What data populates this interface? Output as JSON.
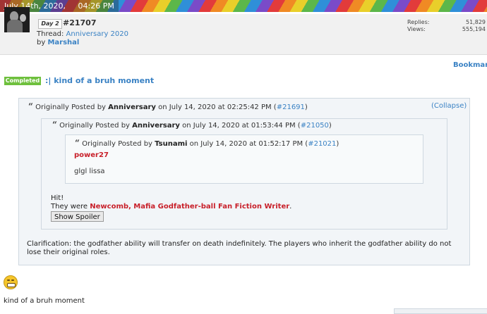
{
  "header": {
    "date": "July 14th, 2020,",
    "time": "04:26 PM"
  },
  "post": {
    "day_badge": "Day 2",
    "number": "#21707",
    "thread_prefix": "Thread:",
    "thread_name": "Anniversary 2020",
    "by_prefix": "by",
    "author": "Marshal",
    "stats": {
      "replies_label": "Replies:",
      "replies_value": "51,829",
      "views_label": "Views:",
      "views_value": "555,194"
    }
  },
  "bookmark_label": "Bookmark",
  "thread_status": {
    "badge": "Completed",
    "title": ":| kind of a bruh moment"
  },
  "quote1": {
    "prefix": "Originally Posted by",
    "author": "Anniversary",
    "date": "on July 14, 2020 at 02:25:42 PM (",
    "link": "#21691",
    "close": ")",
    "collapse": "(Collapse)"
  },
  "quote2": {
    "prefix": "Originally Posted by",
    "author": "Anniversary",
    "date": "on July 14, 2020 at 01:53:44 PM (",
    "link": "#21050",
    "close": ")"
  },
  "quote3": {
    "prefix": "Originally Posted by",
    "author": "Tsunami",
    "date": "on July 14, 2020 at 01:52:17 PM (",
    "link": "#21021",
    "close": ")",
    "name_red": "power27",
    "body": "glgl lissa"
  },
  "quote2_body": {
    "hit": "Hit!",
    "they_were_prefix": "They were",
    "they_were_role": "Newcomb, Mafia Godfather-ball Fan Fiction Writer",
    "they_were_suffix": ".",
    "spoiler_button": "Show Spoiler"
  },
  "clarification": "Clarification: the godfather ability will transfer on death indefinitely. The players who inherit the godfather ability do not lose their original roles.",
  "emoji_name": "grimace-emoji",
  "bottom_text": "kind of a bruh moment"
}
